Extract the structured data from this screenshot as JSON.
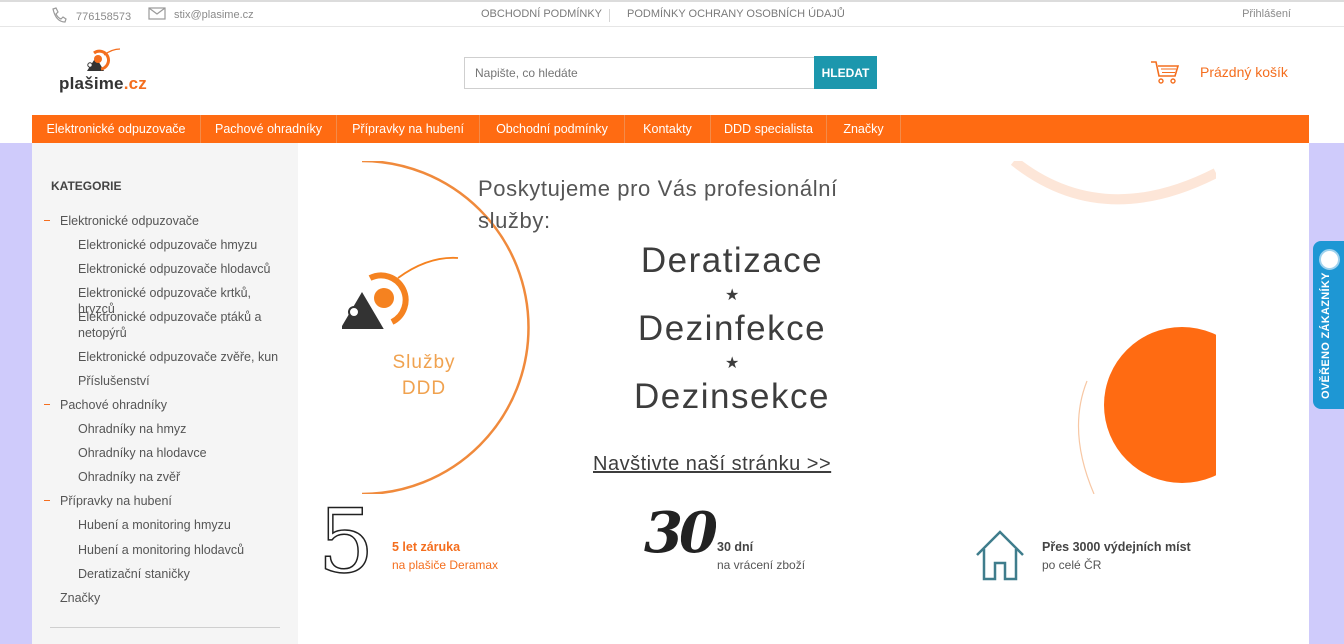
{
  "topbar": {
    "phone": "776158573",
    "email": "stix@plasime.cz",
    "policy_terms": "OBCHODNÍ PODMÍNKY",
    "policy_privacy": "PODMÍNKY OCHRANY OSOBNÍCH ÚDAJŮ",
    "login": "Přihlášení"
  },
  "header": {
    "logo_name": "plašime",
    "logo_tld": ".cz",
    "search_placeholder": "Napište, co hledáte",
    "search_button": "HLEDAT",
    "cart_label": "Prázdný košík"
  },
  "nav": {
    "items": [
      "Elektronické odpuzovače",
      "Pachové ohradníky",
      "Přípravky na hubení",
      "Obchodní podmínky",
      "Kontakty",
      "DDD specialista",
      "Značky"
    ]
  },
  "sidebar": {
    "title": "KATEGORIE",
    "items": [
      {
        "label": "Elektronické odpuzovače",
        "level": "cat",
        "dash": true
      },
      {
        "label": "Elektronické odpuzovače hmyzu",
        "level": "sub"
      },
      {
        "label": "Elektronické odpuzovače hlodavců",
        "level": "sub"
      },
      {
        "label": "Elektronické odpuzovače krtků, hryzců",
        "level": "sub"
      },
      {
        "label": "Elektronické odpuzovače ptáků a netopýrů",
        "level": "sub"
      },
      {
        "label": "Elektronické odpuzovače zvěře, kun",
        "level": "sub"
      },
      {
        "label": "Příslušenství",
        "level": "sub"
      },
      {
        "label": "Pachové ohradníky",
        "level": "cat",
        "dash": true
      },
      {
        "label": "Ohradníky na hmyz",
        "level": "sub"
      },
      {
        "label": "Ohradníky na hlodavce",
        "level": "sub"
      },
      {
        "label": "Ohradníky na zvěř",
        "level": "sub"
      },
      {
        "label": "Přípravky na hubení",
        "level": "cat",
        "dash": true
      },
      {
        "label": "Hubení a monitoring hmyzu",
        "level": "sub"
      },
      {
        "label": "Hubení a monitoring hlodavců",
        "level": "sub"
      },
      {
        "label": "Deratizační staničky",
        "level": "sub"
      },
      {
        "label": "Značky",
        "level": "cat",
        "dash": false
      }
    ]
  },
  "banner": {
    "intro_line1": "Poskytujeme pro Vás profesionální",
    "intro_line2": "služby:",
    "services": [
      "Deratizace",
      "Dezinfekce",
      "Dezinsekce"
    ],
    "star": "★",
    "link": "Navštivte naší stránku >>",
    "logo_line1": "Služby",
    "logo_line2": "DDD"
  },
  "features": [
    {
      "big": "5",
      "title": "5 let záruka",
      "subtitle": "na plašiče Deramax",
      "accent": true
    },
    {
      "big": "30",
      "title": "30 dní",
      "subtitle": "na vrácení zboží",
      "accent": false
    },
    {
      "big": "",
      "title": "Přes 3000 výdejních míst",
      "subtitle": "po celé ČR",
      "accent": false
    }
  ],
  "verified_tab": "OVĚŘENO ZÁKAZNÍKY",
  "colors": {
    "accent": "#ff6b12",
    "search_button": "#1c97ad",
    "verified": "#1e97d4",
    "side_strip": "#cfcbfb",
    "sidebar_bg": "#f5f5f5"
  }
}
